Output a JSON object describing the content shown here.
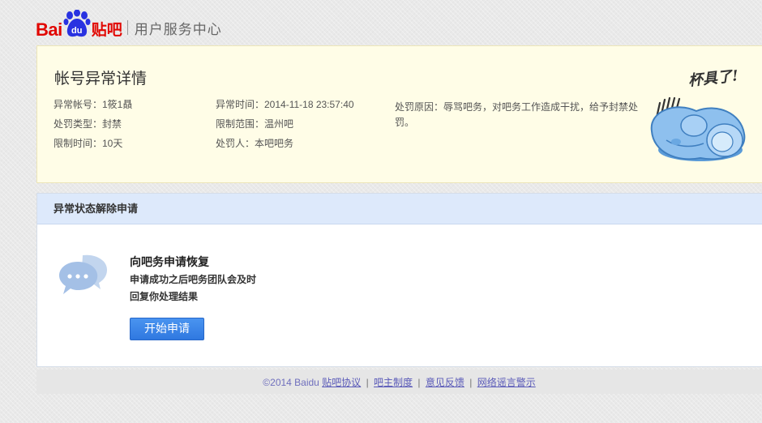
{
  "header": {
    "logo_bai": "Bai",
    "logo_du": "du",
    "logo_tieba": "贴吧",
    "site_title": "用户服务中心"
  },
  "detail": {
    "title": "帐号异常详情",
    "account": "异常帐号：1筱1贔",
    "punish_type": "处罚类型：封禁",
    "limit_time": "限制时间：10天",
    "abnormal_time": "异常时间：2014-11-18 23:57:40",
    "limit_scope": "限制范围：温州吧",
    "punisher": "处罚人：本吧吧务",
    "reason": "处罚原因：辱骂吧务，对吧务工作造成干扰，给予封禁处罚。",
    "mascot_caption": "杯具了!"
  },
  "appeal": {
    "header": "异常状态解除申请",
    "heading": "向吧务申请恢复",
    "desc_line1": "申请成功之后吧务团队会及时",
    "desc_line2": "回复你处理结果",
    "button_label": "开始申请"
  },
  "footer": {
    "copyright": "©2014 Baidu",
    "links": [
      "贴吧协议",
      "吧主制度",
      "意见反馈",
      "网络谣言警示"
    ],
    "separator": "|"
  },
  "colors": {
    "brand_red": "#e10601",
    "brand_blue": "#2932e1",
    "detail_bg": "#fffde7",
    "appeal_header_bg": "#dde9fb",
    "button_blue": "#2f78e0",
    "footer_link": "#5a5ab8"
  },
  "icons": {
    "logo": "baidu-paw-icon",
    "mascot": "crying-mascot-icon",
    "chat": "chat-bubbles-icon"
  }
}
